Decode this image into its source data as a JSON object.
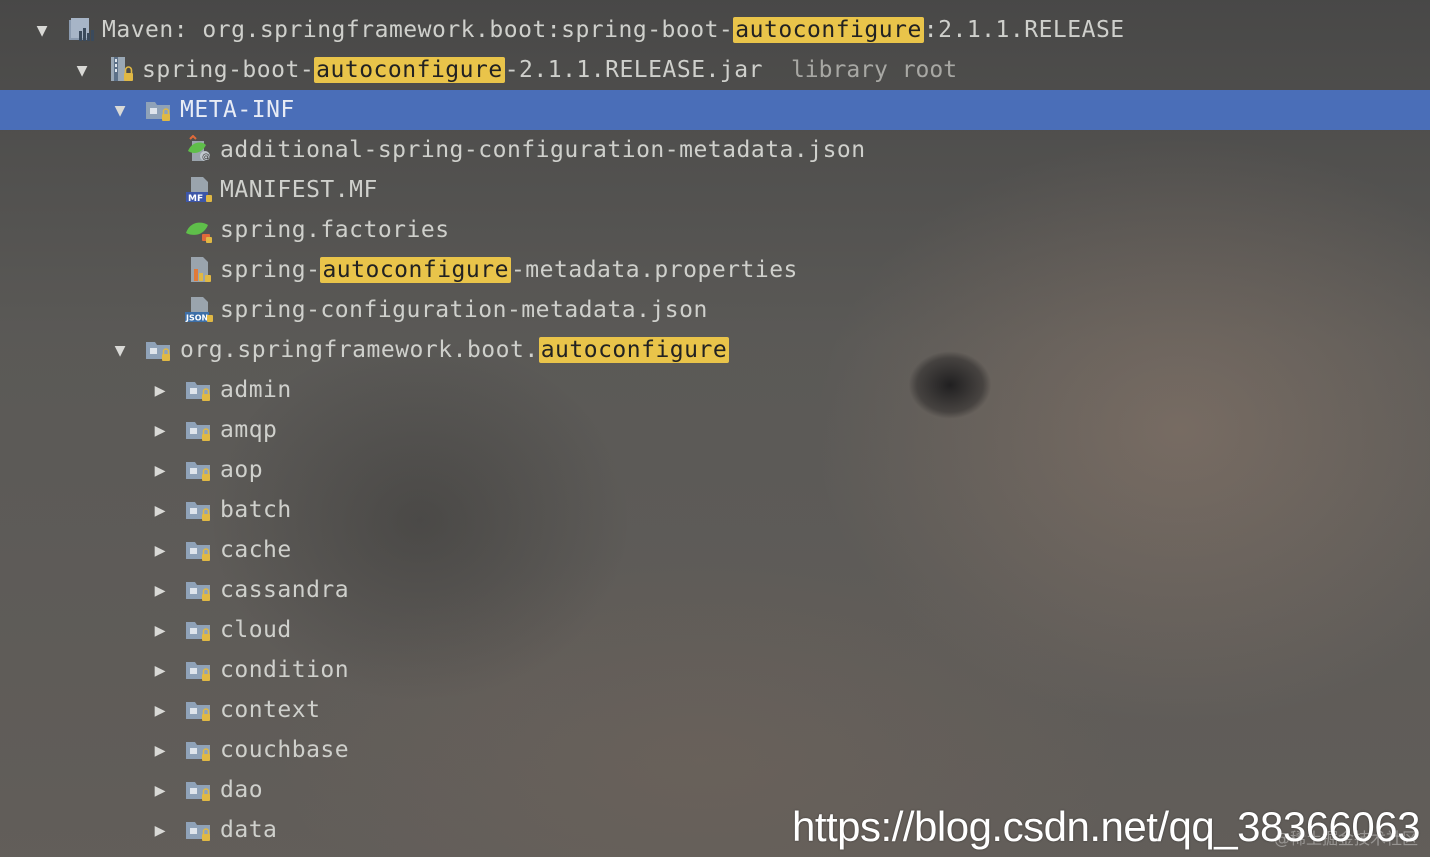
{
  "tree": {
    "maven": {
      "prefix": "Maven: org.springframework.boot:spring-boot-",
      "highlight": "autoconfigure",
      "suffix": ":2.1.1.RELEASE"
    },
    "jar": {
      "prefix": "spring-boot-",
      "highlight": "autoconfigure",
      "suffix": "-2.1.1.RELEASE.jar",
      "note": "library root"
    },
    "metainf": {
      "label": "META-INF"
    },
    "files": [
      {
        "label": "additional-spring-configuration-metadata.json"
      },
      {
        "label": "MANIFEST.MF"
      },
      {
        "label": "spring.factories"
      },
      {
        "prefix": "spring-",
        "highlight": "autoconfigure",
        "suffix": "-metadata.properties"
      },
      {
        "label": "spring-configuration-metadata.json"
      }
    ],
    "package": {
      "prefix": "org.springframework.boot.",
      "highlight": "autoconfigure"
    },
    "subpackages": [
      "admin",
      "amqp",
      "aop",
      "batch",
      "cache",
      "cassandra",
      "cloud",
      "condition",
      "context",
      "couchbase",
      "dao",
      "data"
    ]
  },
  "watermark": {
    "url": "https://blog.csdn.net/qq_38366063",
    "sub": "@稀土掘金技术社区"
  },
  "colors": {
    "selection": "#4a6eb8",
    "highlight": "#e9c44a",
    "folder": "#8fa2b8",
    "lock": "#e0b844"
  },
  "icons": {
    "expanded": "triangle-down-icon",
    "collapsed": "triangle-right-icon",
    "folder": "package-folder-icon",
    "jar": "jar-archive-icon",
    "maven": "maven-library-icon"
  }
}
